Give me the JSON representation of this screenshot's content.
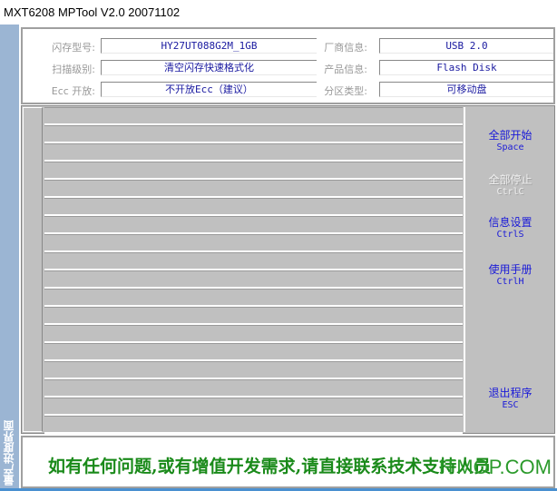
{
  "window": {
    "title": "MXT6208 MPTool V2.0 20071102"
  },
  "side_tab": "量产进度界面",
  "info": [
    {
      "label": "闪存型号:",
      "value": "HY27UT088G2M_1GB"
    },
    {
      "label": "扫描级别:",
      "value": "清空闪存快速格式化"
    },
    {
      "label": "Ecc 开放:",
      "value": "不开放Ecc（建议）"
    },
    {
      "label": "厂商信息:",
      "value": "USB 2.0"
    },
    {
      "label": "产品信息:",
      "value": "Flash Disk"
    },
    {
      "label": "分区类型:",
      "value": "可移动盘"
    }
  ],
  "buttons": [
    {
      "label": "全部开始",
      "shortcut": "Space",
      "enabled": true
    },
    {
      "label": "全部停止",
      "shortcut": "CtrlC",
      "enabled": false
    },
    {
      "label": "信息设置",
      "shortcut": "CtrlS",
      "enabled": true
    },
    {
      "label": "使用手册",
      "shortcut": "CtrlH",
      "enabled": true
    },
    {
      "label": "退出程序",
      "shortcut": "ESC",
      "enabled": true
    }
  ],
  "message": "如有任何问题,或有增值开发需求,请直接联系技术支持人员",
  "watermark": "ITMOP.COM",
  "colors": {
    "strip": "#9bb5d3",
    "panel": "#c0c0c0",
    "button_text": "#1a1ad8",
    "message": "#1a8a1a"
  }
}
